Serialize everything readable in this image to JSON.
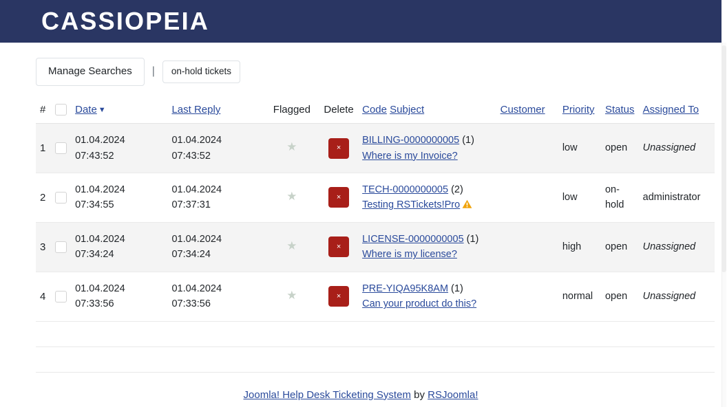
{
  "header": {
    "brand": "CASSIOPEIA",
    "brand_bg": "#2a3663"
  },
  "toolbar": {
    "manage_searches_label": "Manage Searches",
    "separator": "|",
    "saved_search_label": "on-hold tickets"
  },
  "table": {
    "columns": {
      "num": "#",
      "select_all": "",
      "date": "Date",
      "date_sort_caret": "▼",
      "last_reply": "Last Reply",
      "flagged": "Flagged",
      "delete": "Delete",
      "code": "Code",
      "subject": "Subject",
      "customer": "Customer",
      "priority": "Priority",
      "status": "Status",
      "assigned_to": "Assigned To"
    },
    "delete_button_label": "×",
    "flag_icon": "★",
    "rows": [
      {
        "num": "1",
        "date_date": "01.04.2024",
        "date_time": "07:43:52",
        "reply_date": "01.04.2024",
        "reply_time": "07:43:52",
        "code": "BILLING-0000000005",
        "count": "(1)",
        "subject": "Where is my Invoice?",
        "warning": false,
        "customer": "",
        "priority": "low",
        "status": "open",
        "assigned_to": "Unassigned",
        "assigned_italic": true
      },
      {
        "num": "2",
        "date_date": "01.04.2024",
        "date_time": "07:34:55",
        "reply_date": "01.04.2024",
        "reply_time": "07:37:31",
        "code": "TECH-0000000005",
        "count": "(2)",
        "subject": "Testing RSTickets!Pro",
        "warning": true,
        "customer": "",
        "priority": "low",
        "status": "on-hold",
        "assigned_to": "administrator",
        "assigned_italic": false
      },
      {
        "num": "3",
        "date_date": "01.04.2024",
        "date_time": "07:34:24",
        "reply_date": "01.04.2024",
        "reply_time": "07:34:24",
        "code": "LICENSE-0000000005",
        "count": "(1)",
        "subject": "Where is my license?",
        "warning": false,
        "customer": "",
        "priority": "high",
        "status": "open",
        "assigned_to": "Unassigned",
        "assigned_italic": true
      },
      {
        "num": "4",
        "date_date": "01.04.2024",
        "date_time": "07:33:56",
        "reply_date": "01.04.2024",
        "reply_time": "07:33:56",
        "code": "PRE-YIQA95K8AM",
        "count": "(1)",
        "subject": "Can your product do this?",
        "warning": false,
        "customer": "",
        "priority": "normal",
        "status": "open",
        "assigned_to": "Unassigned",
        "assigned_italic": true
      }
    ]
  },
  "footer": {
    "link_text": "Joomla! Help Desk Ticketing System",
    "by_text": "by",
    "vendor_link": "RSJoomla!"
  },
  "colors": {
    "brand_bg": "#2a3663",
    "link": "#2a4a9b",
    "delete_red": "#a81f19",
    "warning_amber": "#f0a30a",
    "star_gray": "#c7d2c9",
    "row_stripe": "#f4f4f4"
  }
}
